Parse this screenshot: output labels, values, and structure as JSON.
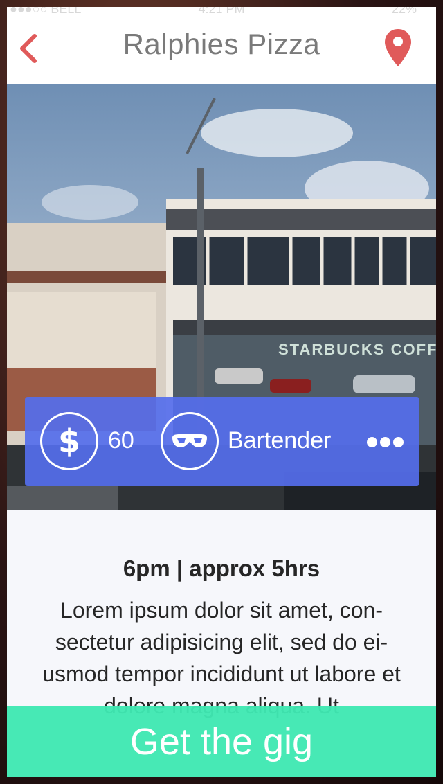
{
  "status_bar": {
    "carrier": "●●●○○ BELL",
    "time": "4:21 PM",
    "battery": "22%"
  },
  "header": {
    "title": "Ralphies Pizza",
    "back_icon": "chevron-left-icon",
    "location_icon": "map-pin-icon"
  },
  "photo": {
    "sign_text": "STARBUCKS COFFE"
  },
  "gig": {
    "pay_icon": "dollar-icon",
    "pay_glyph": "$",
    "pay_value": "60",
    "role_icon": "glasses-icon",
    "role": "Bartender",
    "more_icon": "more-icon",
    "time": "6pm | approx 5hrs",
    "description": "Lorem ipsum dolor sit amet, con-sectetur adipisicing elit, sed do ei-usmod tempor incididunt ut labore et dolore magna aliqua. Ut"
  },
  "cta": {
    "label": "Get the gig"
  },
  "colors": {
    "accent_red": "#e05a5a",
    "info_bar": "#556eeb",
    "cta": "#40e8b2"
  }
}
